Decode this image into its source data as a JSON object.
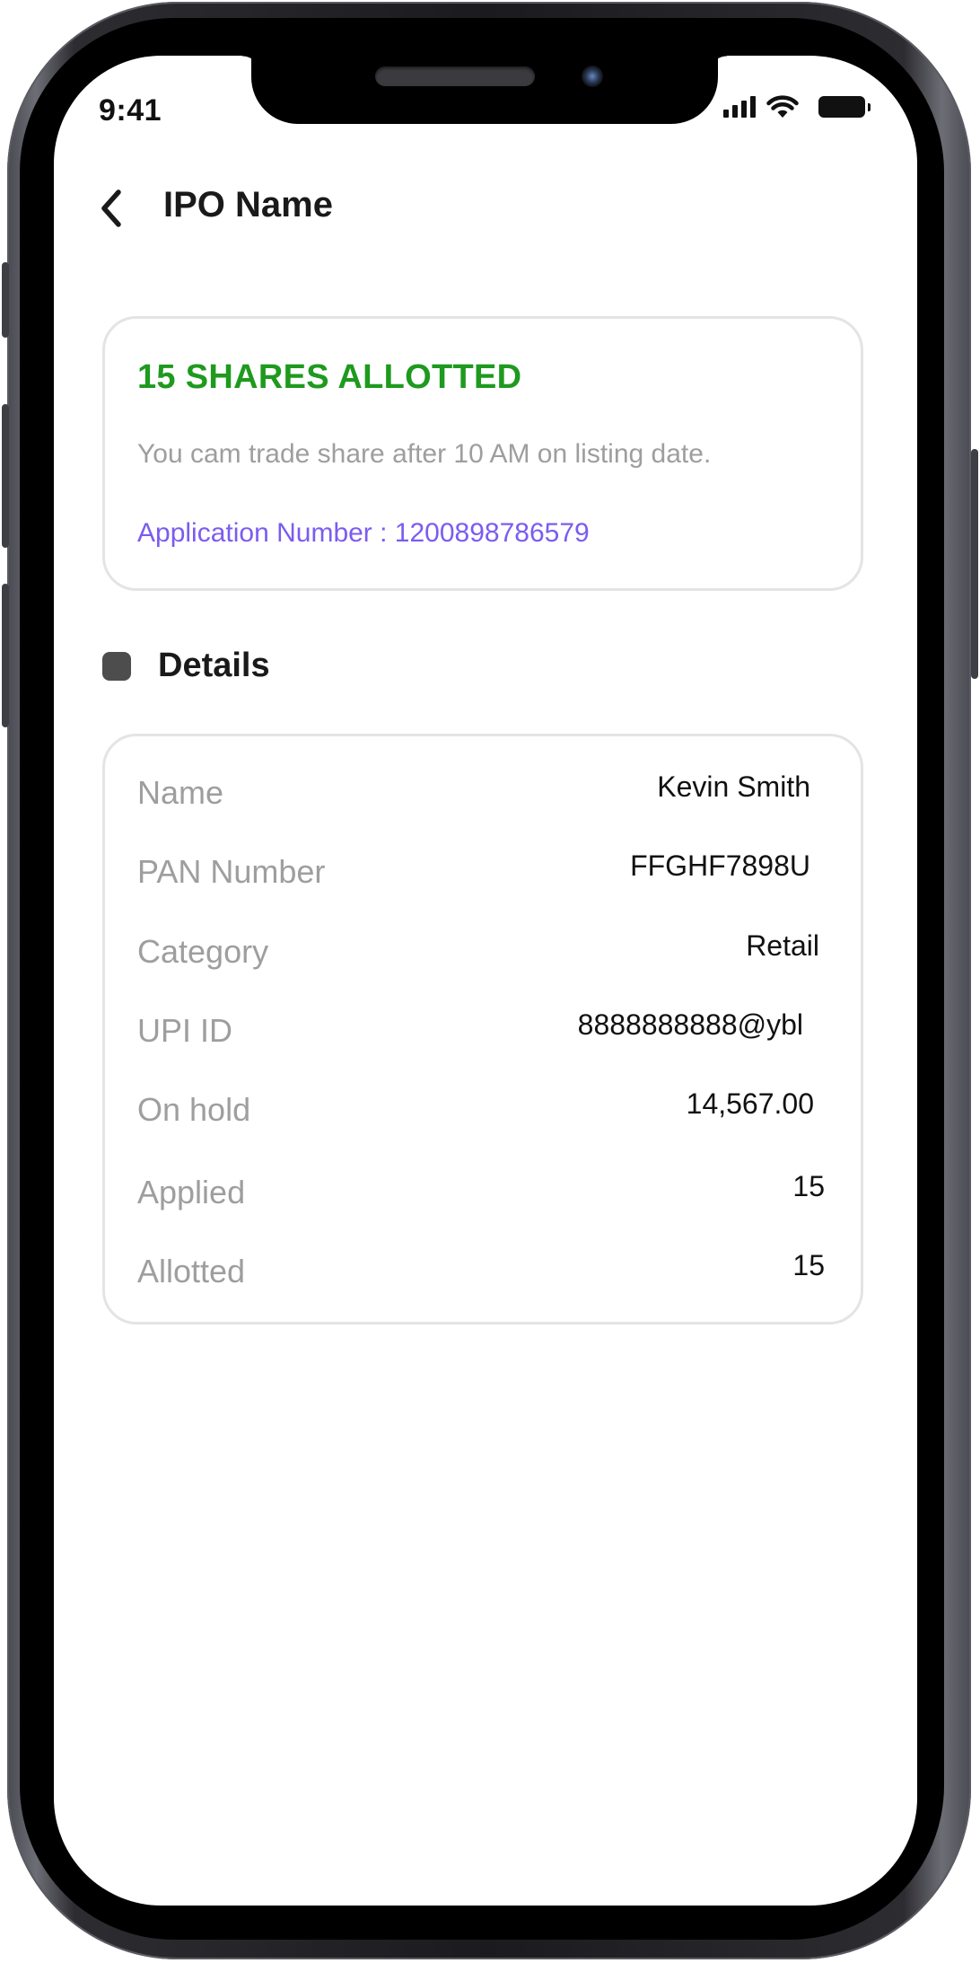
{
  "status_bar": {
    "time": "9:41"
  },
  "header": {
    "title": "IPO Name"
  },
  "allotment": {
    "title": "15 SHARES ALLOTTED",
    "note": "You cam trade share after 10 AM on listing date.",
    "application_number": "Application Number : 1200898786579"
  },
  "details": {
    "section_title": "Details",
    "rows": [
      {
        "label": "Name",
        "value": "Kevin Smith"
      },
      {
        "label": "PAN Number",
        "value": "FFGHF7898U"
      },
      {
        "label": "Category",
        "value": "Retail"
      },
      {
        "label": "UPI ID",
        "value": "8888888888@ybl"
      },
      {
        "label": "On hold",
        "value": "14,567.00"
      },
      {
        "label": "Applied",
        "value": "15"
      },
      {
        "label": "Allotted",
        "value": "15"
      }
    ]
  },
  "colors": {
    "success": "#1e9a1e",
    "accent": "#7b5cf0",
    "muted": "#9e9e9e"
  },
  "icons": {
    "back": "chevron-left-icon",
    "signal": "cellular-signal-icon",
    "wifi": "wifi-icon",
    "battery": "battery-icon"
  }
}
